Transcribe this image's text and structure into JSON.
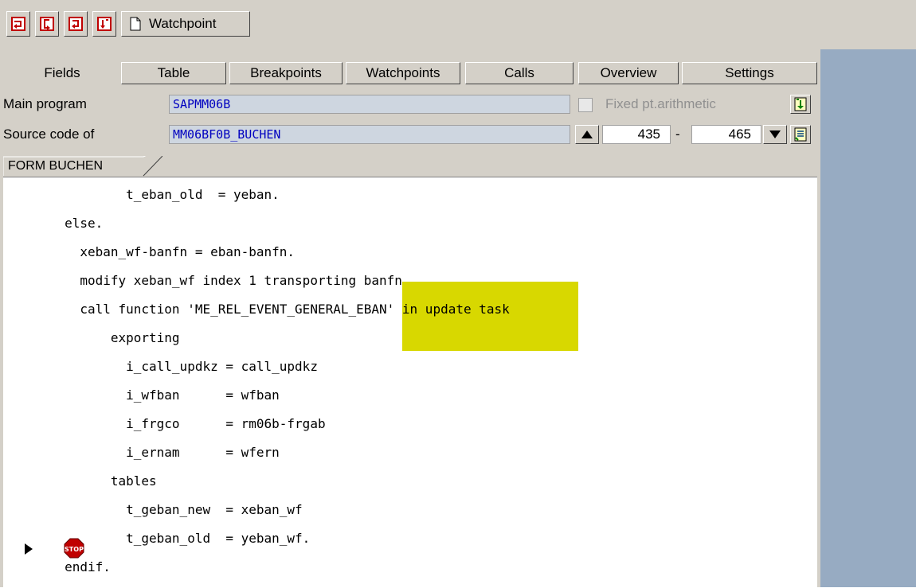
{
  "toolbar": {
    "watchpoint_label": "Watchpoint"
  },
  "tabs": [
    "Fields",
    "Table",
    "Breakpoints",
    "Watchpoints",
    "Calls",
    "Overview",
    "Settings"
  ],
  "main_program": {
    "label": "Main program",
    "value": "SAPMM06B",
    "fixed_pt_label": "Fixed pt.arithmetic"
  },
  "source_code": {
    "label": "Source code of",
    "value": "MM06BF0B_BUCHEN",
    "line_from": "435",
    "dash": "-",
    "line_to": "465"
  },
  "source_tab": "FORM BUCHEN",
  "code_lines": [
    "                t_eban_old  = yeban.",
    "        else.",
    "          xeban_wf-banfn = eban-banfn.",
    "          modify xeban_wf index 1 transporting banfn.",
    "          call function 'ME_REL_EVENT_GENERAL_EBAN' ",
    "              exporting",
    "                i_call_updkz = call_updkz",
    "                i_wfban      = wfban",
    "                i_frgco      = rm06b-frgab",
    "                i_ernam      = wfern",
    "              tables",
    "                t_geban_new  = xeban_wf",
    "                t_geban_old  = yeban_wf.",
    "        endif."
  ],
  "highlight_text": "in update task",
  "colors": {
    "highlight": "#d8d800",
    "field_text": "#0000c0",
    "side_blue": "#97abc2"
  }
}
